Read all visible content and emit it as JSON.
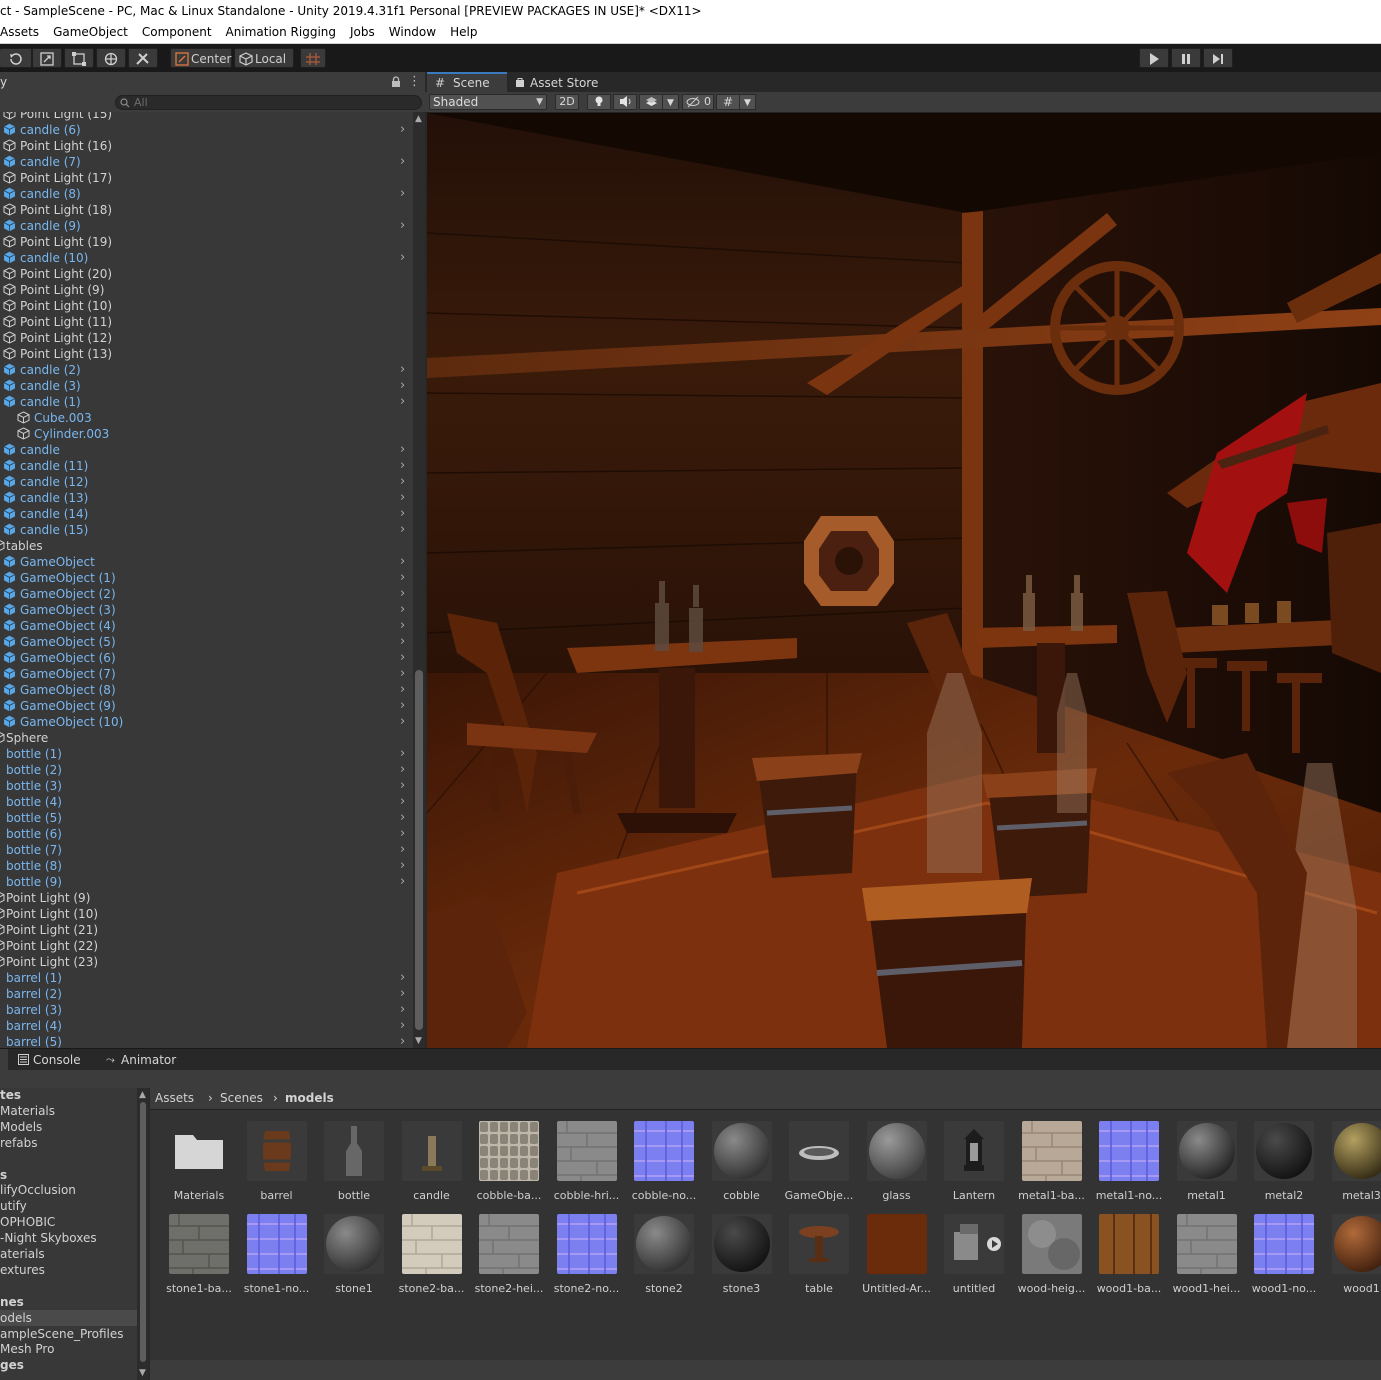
{
  "window": {
    "title": "ct - SampleScene - PC, Mac & Linux Standalone - Unity 2019.4.31f1 Personal [PREVIEW PACKAGES IN USE]* <DX11>"
  },
  "menu": [
    "Assets",
    "GameObject",
    "Component",
    "Animation Rigging",
    "Jobs",
    "Window",
    "Help"
  ],
  "toolbar": {
    "pivot_label": "Center",
    "space_label": "Local",
    "icons": [
      "rotate-icon",
      "scale-icon",
      "rect-tool-icon",
      "transform-tool-icon",
      "custom-tool-icon",
      "grid-snap-icon",
      "play-icon",
      "pause-icon",
      "step-icon"
    ]
  },
  "hierarchy": {
    "tab_label": "y",
    "search_placeholder": "All",
    "rows": [
      {
        "label": "Point Light (15)",
        "kind": "light",
        "indent": 0,
        "arrow": false
      },
      {
        "label": "candle (6)",
        "kind": "prefab",
        "indent": 0,
        "arrow": true
      },
      {
        "label": "Point Light (16)",
        "kind": "light",
        "indent": 0,
        "arrow": false
      },
      {
        "label": "candle (7)",
        "kind": "prefab",
        "indent": 0,
        "arrow": true
      },
      {
        "label": "Point Light (17)",
        "kind": "light",
        "indent": 0,
        "arrow": false
      },
      {
        "label": "candle (8)",
        "kind": "prefab",
        "indent": 0,
        "arrow": true
      },
      {
        "label": "Point Light (18)",
        "kind": "light",
        "indent": 0,
        "arrow": false
      },
      {
        "label": "candle (9)",
        "kind": "prefab",
        "indent": 0,
        "arrow": true
      },
      {
        "label": "Point Light (19)",
        "kind": "light",
        "indent": 0,
        "arrow": false
      },
      {
        "label": "candle (10)",
        "kind": "prefab",
        "indent": 0,
        "arrow": true
      },
      {
        "label": "Point Light (20)",
        "kind": "light",
        "indent": 0,
        "arrow": false
      },
      {
        "label": "Point Light (9)",
        "kind": "light",
        "indent": 0,
        "arrow": false
      },
      {
        "label": "Point Light (10)",
        "kind": "light",
        "indent": 0,
        "arrow": false
      },
      {
        "label": "Point Light (11)",
        "kind": "light",
        "indent": 0,
        "arrow": false
      },
      {
        "label": "Point Light (12)",
        "kind": "light",
        "indent": 0,
        "arrow": false
      },
      {
        "label": "Point Light (13)",
        "kind": "light",
        "indent": 0,
        "arrow": false
      },
      {
        "label": "candle (2)",
        "kind": "prefab",
        "indent": 0,
        "arrow": true
      },
      {
        "label": "candle (3)",
        "kind": "prefab",
        "indent": 0,
        "arrow": true
      },
      {
        "label": "candle (1)",
        "kind": "prefab",
        "indent": 0,
        "arrow": true
      },
      {
        "label": "Cube.003",
        "kind": "child",
        "indent": 1,
        "arrow": false
      },
      {
        "label": "Cylinder.003",
        "kind": "child",
        "indent": 1,
        "arrow": false
      },
      {
        "label": "candle",
        "kind": "prefab",
        "indent": 0,
        "arrow": true
      },
      {
        "label": "candle (11)",
        "kind": "prefab",
        "indent": 0,
        "arrow": true
      },
      {
        "label": "candle (12)",
        "kind": "prefab",
        "indent": 0,
        "arrow": true
      },
      {
        "label": "candle (13)",
        "kind": "prefab",
        "indent": 0,
        "arrow": true
      },
      {
        "label": "candle (14)",
        "kind": "prefab",
        "indent": 0,
        "arrow": true
      },
      {
        "label": "candle (15)",
        "kind": "prefab",
        "indent": 0,
        "arrow": true
      },
      {
        "label": "tables",
        "kind": "group",
        "indent": -1,
        "arrow": false
      },
      {
        "label": "GameObject",
        "kind": "prefab",
        "indent": 0,
        "arrow": true
      },
      {
        "label": "GameObject (1)",
        "kind": "prefab",
        "indent": 0,
        "arrow": true
      },
      {
        "label": "GameObject (2)",
        "kind": "prefab",
        "indent": 0,
        "arrow": true
      },
      {
        "label": "GameObject (3)",
        "kind": "prefab",
        "indent": 0,
        "arrow": true
      },
      {
        "label": "GameObject (4)",
        "kind": "prefab",
        "indent": 0,
        "arrow": true
      },
      {
        "label": "GameObject (5)",
        "kind": "prefab",
        "indent": 0,
        "arrow": true
      },
      {
        "label": "GameObject (6)",
        "kind": "prefab",
        "indent": 0,
        "arrow": true
      },
      {
        "label": "GameObject (7)",
        "kind": "prefab",
        "indent": 0,
        "arrow": true
      },
      {
        "label": "GameObject (8)",
        "kind": "prefab",
        "indent": 0,
        "arrow": true
      },
      {
        "label": "GameObject (9)",
        "kind": "prefab",
        "indent": 0,
        "arrow": true
      },
      {
        "label": "GameObject (10)",
        "kind": "prefab",
        "indent": 0,
        "arrow": true
      },
      {
        "label": "Sphere",
        "kind": "group",
        "indent": -1,
        "arrow": false
      },
      {
        "label": "bottle (1)",
        "kind": "prefab-noicon",
        "indent": -1,
        "arrow": true
      },
      {
        "label": "bottle (2)",
        "kind": "prefab-noicon",
        "indent": -1,
        "arrow": true
      },
      {
        "label": "bottle (3)",
        "kind": "prefab-noicon",
        "indent": -1,
        "arrow": true
      },
      {
        "label": "bottle (4)",
        "kind": "prefab-noicon",
        "indent": -1,
        "arrow": true
      },
      {
        "label": "bottle (5)",
        "kind": "prefab-noicon",
        "indent": -1,
        "arrow": true
      },
      {
        "label": "bottle (6)",
        "kind": "prefab-noicon",
        "indent": -1,
        "arrow": true
      },
      {
        "label": "bottle (7)",
        "kind": "prefab-noicon",
        "indent": -1,
        "arrow": true
      },
      {
        "label": "bottle (8)",
        "kind": "prefab-noicon",
        "indent": -1,
        "arrow": true
      },
      {
        "label": "bottle (9)",
        "kind": "prefab-noicon",
        "indent": -1,
        "arrow": true
      },
      {
        "label": "Point Light (9)",
        "kind": "group",
        "indent": -1,
        "arrow": false
      },
      {
        "label": "Point Light (10)",
        "kind": "group",
        "indent": -1,
        "arrow": false
      },
      {
        "label": "Point Light (21)",
        "kind": "group",
        "indent": -1,
        "arrow": false
      },
      {
        "label": "Point Light (22)",
        "kind": "group",
        "indent": -1,
        "arrow": false
      },
      {
        "label": "Point Light (23)",
        "kind": "group",
        "indent": -1,
        "arrow": false
      },
      {
        "label": "barrel (1)",
        "kind": "prefab-noicon",
        "indent": -1,
        "arrow": true
      },
      {
        "label": "barrel (2)",
        "kind": "prefab-noicon",
        "indent": -1,
        "arrow": true
      },
      {
        "label": "barrel (3)",
        "kind": "prefab-noicon",
        "indent": -1,
        "arrow": true
      },
      {
        "label": "barrel (4)",
        "kind": "prefab-noicon",
        "indent": -1,
        "arrow": true
      },
      {
        "label": "barrel (5)",
        "kind": "prefab-noicon",
        "indent": -1,
        "arrow": true
      }
    ]
  },
  "scene": {
    "tabs": [
      {
        "label": "Scene",
        "icon": "grid-icon"
      },
      {
        "label": "Asset Store",
        "icon": "bag-icon"
      }
    ],
    "shading_mode": "Shaded",
    "mode_2d_label": "2D",
    "hidden_count": "0"
  },
  "bottom": {
    "tabs": [
      {
        "label": "Console",
        "icon": "console-icon"
      },
      {
        "label": "Animator",
        "icon": "animator-icon"
      }
    ],
    "tree": [
      "tes",
      "Materials",
      "Models",
      "refabs",
      "",
      "s",
      "lifyOcclusion",
      "utify",
      "OPHOBIC",
      "-Night Skyboxes",
      "aterials",
      "extures",
      "",
      "nes",
      "odels",
      "ampleScene_Profiles",
      "Mesh Pro",
      "ges"
    ],
    "tree_selected": "odels",
    "breadcrumb": [
      "Assets",
      "Scenes",
      "models"
    ],
    "assets_row1": [
      {
        "label": "Materials",
        "kind": "folder"
      },
      {
        "label": "barrel",
        "kind": "barrel"
      },
      {
        "label": "bottle",
        "kind": "bottle"
      },
      {
        "label": "candle",
        "kind": "candle"
      },
      {
        "label": "cobble-ba...",
        "kind": "cobble-tex"
      },
      {
        "label": "cobble-hri...",
        "kind": "gray-tex"
      },
      {
        "label": "cobble-no...",
        "kind": "normal-tex"
      },
      {
        "label": "cobble",
        "kind": "rock-sphere"
      },
      {
        "label": "GameObje...",
        "kind": "gameobject"
      },
      {
        "label": "glass",
        "kind": "glass-sphere"
      },
      {
        "label": "Lantern",
        "kind": "lantern"
      },
      {
        "label": "metal1-ba...",
        "kind": "metal-tex"
      },
      {
        "label": "metal1-no...",
        "kind": "normal-tex"
      },
      {
        "label": "metal1",
        "kind": "metal-sphere"
      },
      {
        "label": "metal2",
        "kind": "dark-sphere"
      },
      {
        "label": "metal3",
        "kind": "gold-sphere"
      }
    ],
    "assets_row2": [
      {
        "label": "stone1-ba...",
        "kind": "stone-tex"
      },
      {
        "label": "stone1-no...",
        "kind": "normal-tex"
      },
      {
        "label": "stone1",
        "kind": "rock-sphere"
      },
      {
        "label": "stone2-ba...",
        "kind": "stone2-tex"
      },
      {
        "label": "stone2-hei...",
        "kind": "gray-tex"
      },
      {
        "label": "stone2-no...",
        "kind": "normal-tex"
      },
      {
        "label": "stone2",
        "kind": "rock-sphere"
      },
      {
        "label": "stone3",
        "kind": "dark-sphere"
      },
      {
        "label": "table",
        "kind": "table"
      },
      {
        "label": "Untitled-Ar...",
        "kind": "brown-tex"
      },
      {
        "label": "untitled",
        "kind": "untitled"
      },
      {
        "label": "wood-heig...",
        "kind": "cloud-tex"
      },
      {
        "label": "wood1-ba...",
        "kind": "wood-tex"
      },
      {
        "label": "wood1-hei...",
        "kind": "gray-tex"
      },
      {
        "label": "wood1-no...",
        "kind": "normal-tex"
      },
      {
        "label": "wood1",
        "kind": "wood-sphere"
      }
    ]
  },
  "colors": {
    "prefab_text": "#79b7f0",
    "accent": "#3a79bb",
    "panel": "#383838"
  }
}
